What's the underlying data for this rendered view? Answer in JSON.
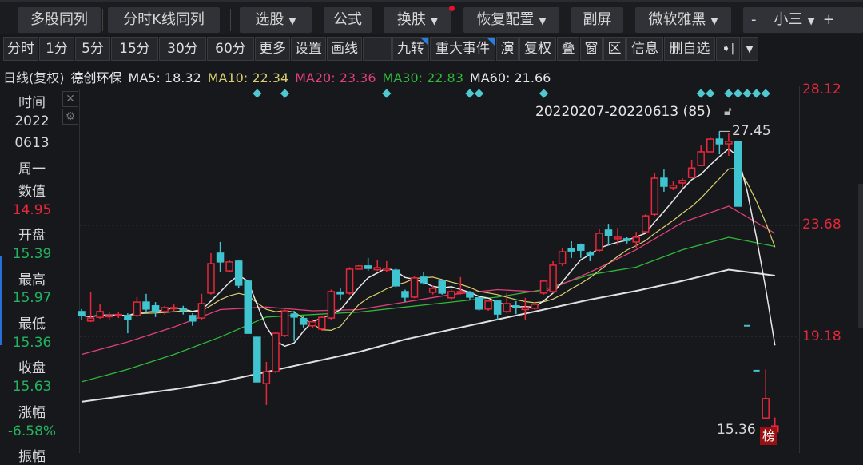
{
  "toolbar": {
    "buttons": [
      {
        "label": "多股同列"
      },
      {
        "label": "分时K线同列"
      },
      {
        "label": "选股",
        "dropdown": true
      },
      {
        "label": "公式"
      },
      {
        "label": "换肤",
        "dropdown": true
      },
      {
        "label": "恢复配置",
        "dropdown": true
      },
      {
        "label": "副屏"
      },
      {
        "label": "微软雅黑",
        "dropdown": true
      }
    ],
    "font_size": {
      "minus": "-",
      "value": "小三",
      "plus": "+"
    },
    "dropdown_arrow": "▼"
  },
  "periods": [
    "分时",
    "1分",
    "5分",
    "15分",
    "30分",
    "60分",
    "更多",
    "设置",
    "画线"
  ],
  "tools": [
    "九转",
    "重大事件",
    "演",
    "复权",
    "叠",
    "窗",
    "区",
    "信息",
    "删自选"
  ],
  "tools_extra": {
    "pin": "➧|",
    "more": "▼"
  },
  "info": {
    "period": "日线(复权)",
    "name": "德创环保",
    "ma5": "MA5: 18.32",
    "ma10": "MA10: 22.34",
    "ma20": "MA20: 23.36",
    "ma30": "MA30: 22.83",
    "ma60": "MA60: 21.66"
  },
  "colors": {
    "up": "#e8283c",
    "down": "#3fc4d0",
    "ma5": "#e8e8e8",
    "ma10": "#d8d070",
    "ma20": "#e0407a",
    "ma30": "#2fb83a",
    "ma60": "#e0e0e0",
    "green_value": "#22b45e"
  },
  "sidebar": [
    {
      "text": "时间",
      "c": "w"
    },
    {
      "text": "2022",
      "c": "w"
    },
    {
      "text": "0613",
      "c": "w"
    },
    {
      "text": "周一",
      "c": "w"
    },
    {
      "text": "数值",
      "c": "w"
    },
    {
      "text": "14.95",
      "c": "r"
    },
    {
      "text": "开盘",
      "c": "w"
    },
    {
      "text": "15.39",
      "c": "g"
    },
    {
      "text": "最高",
      "c": "w"
    },
    {
      "text": "15.97",
      "c": "g"
    },
    {
      "text": "最低",
      "c": "w"
    },
    {
      "text": "15.36",
      "c": "g"
    },
    {
      "text": "收盘",
      "c": "w"
    },
    {
      "text": "15.63",
      "c": "g"
    },
    {
      "text": "涨幅",
      "c": "w"
    },
    {
      "text": "-6.58%",
      "c": "g"
    },
    {
      "text": "振幅",
      "c": "w"
    }
  ],
  "sidebar_icons": {
    "close": "✕",
    "gear": "⚙"
  },
  "chart_data": {
    "type": "candlestick",
    "yaxis_labels": [
      "28.12",
      "23.68",
      "19.18"
    ],
    "range_label": "20220207-20220613 (85)",
    "high_label": "27.45",
    "low_label": "15.36",
    "badge": "榜",
    "marker_indices": [
      19,
      22,
      33,
      42,
      43,
      50,
      67,
      68,
      70,
      71,
      72,
      73,
      74
    ],
    "candles": [
      [
        20.22,
        20.06,
        20.32,
        19.9
      ],
      [
        19.84,
        19.96,
        21.02,
        19.8
      ],
      [
        19.99,
        20.22,
        20.54,
        19.93
      ],
      [
        20.06,
        20.06,
        20.22,
        19.9
      ],
      [
        20.06,
        20.1,
        20.22,
        19.96
      ],
      [
        20.06,
        19.9,
        20.15,
        19.35
      ],
      [
        20.06,
        20.6,
        20.8,
        20.0
      ],
      [
        20.6,
        20.32,
        20.93,
        20.17
      ],
      [
        20.45,
        20.22,
        20.6,
        20.0
      ],
      [
        20.22,
        20.38,
        20.45,
        20.1
      ],
      [
        20.35,
        20.38,
        20.5,
        20.25
      ],
      [
        20.32,
        20.3,
        20.45,
        20.1
      ],
      [
        20.06,
        19.84,
        20.15,
        19.65
      ],
      [
        19.96,
        20.54,
        20.93,
        19.9
      ],
      [
        20.96,
        22.14,
        22.56,
        20.9
      ],
      [
        22.56,
        22.21,
        23.01,
        21.82
      ],
      [
        21.85,
        22.21,
        22.3,
        21.8
      ],
      [
        22.24,
        21.28,
        22.3,
        21.18
      ],
      [
        21.44,
        19.35,
        21.44,
        19.35
      ],
      [
        19.19,
        17.4,
        19.19,
        17.4
      ],
      [
        17.33,
        17.81,
        18.2,
        16.47
      ],
      [
        17.81,
        19.35,
        19.42,
        17.75
      ],
      [
        19.26,
        20.25,
        20.3,
        19.2
      ],
      [
        20.12,
        20.0,
        20.25,
        19.04
      ],
      [
        19.94,
        19.71,
        20.06,
        19.58
      ],
      [
        19.65,
        19.81,
        19.9,
        19.55
      ],
      [
        19.52,
        19.99,
        20.06,
        19.45
      ],
      [
        19.96,
        21.02,
        21.1,
        19.9
      ],
      [
        21.0,
        20.93,
        21.15,
        20.67
      ],
      [
        20.96,
        21.92,
        22.0,
        20.9
      ],
      [
        21.92,
        22.05,
        22.08,
        21.9
      ],
      [
        22.05,
        21.95,
        22.37,
        21.85
      ],
      [
        21.9,
        21.98,
        22.3,
        21.85
      ],
      [
        21.88,
        21.95,
        22.24,
        21.82
      ],
      [
        21.88,
        21.25,
        21.95,
        21.2
      ],
      [
        21.02,
        20.8,
        21.1,
        20.6
      ],
      [
        20.8,
        21.57,
        21.65,
        20.75
      ],
      [
        21.6,
        21.38,
        21.8,
        21.3
      ],
      [
        20.99,
        21.15,
        21.25,
        20.9
      ],
      [
        21.44,
        20.96,
        21.5,
        20.9
      ],
      [
        20.77,
        21.02,
        21.1,
        20.7
      ],
      [
        20.96,
        21.02,
        21.6,
        20.9
      ],
      [
        20.96,
        20.8,
        21.05,
        20.7
      ],
      [
        20.77,
        20.32,
        20.85,
        20.25
      ],
      [
        20.32,
        20.64,
        20.7,
        20.25
      ],
      [
        20.64,
        20.12,
        20.7,
        19.9
      ],
      [
        20.22,
        20.54,
        20.96,
        20.15
      ],
      [
        20.45,
        20.4,
        20.64,
        20.12
      ],
      [
        20.3,
        20.38,
        20.77,
        19.9
      ],
      [
        20.35,
        20.51,
        20.6,
        20.3
      ],
      [
        20.96,
        21.44,
        21.5,
        20.9
      ],
      [
        21.02,
        22.08,
        22.24,
        20.96
      ],
      [
        22.14,
        22.62,
        22.78,
        22.05
      ],
      [
        22.75,
        22.65,
        23.04,
        22.37
      ],
      [
        22.91,
        22.68,
        22.95,
        22.37
      ],
      [
        22.56,
        22.5,
        22.65,
        22.24
      ],
      [
        22.68,
        23.36,
        23.52,
        22.62
      ],
      [
        23.49,
        23.26,
        23.74,
        22.88
      ],
      [
        23.14,
        23.2,
        23.58,
        22.88
      ],
      [
        23.14,
        23.07,
        23.2,
        22.95
      ],
      [
        23.01,
        23.2,
        23.42,
        22.78
      ],
      [
        23.42,
        24.06,
        24.12,
        23.36
      ],
      [
        24.12,
        25.57,
        25.76,
        24.06
      ],
      [
        25.57,
        25.25,
        25.92,
        25.03
      ],
      [
        25.19,
        25.29,
        25.44,
        25.09
      ],
      [
        25.38,
        25.48,
        25.57,
        25.19
      ],
      [
        25.6,
        25.98,
        26.31,
        25.57
      ],
      [
        26.08,
        26.63,
        26.88,
        26.05
      ],
      [
        26.63,
        27.14,
        27.2,
        26.6
      ],
      [
        27.14,
        26.95,
        27.45,
        26.53
      ],
      [
        26.95,
        27.05,
        27.37,
        26.47
      ],
      [
        27.05,
        24.45,
        27.05,
        24.45
      ],
      [
        19.65,
        19.65,
        19.65,
        19.65
      ],
      [
        17.85,
        17.85,
        17.85,
        17.85
      ],
      [
        15.95,
        16.73,
        17.9,
        15.9
      ],
      [
        15.39,
        15.63,
        15.97,
        15.36
      ]
    ],
    "ma_sample_step": 5,
    "ma20": [
      18.5,
      19.0,
      19.6,
      20.3,
      20.4,
      20.25,
      20.3,
      20.6,
      20.9,
      21.1,
      21.0,
      21.8,
      22.7,
      23.8,
      24.45,
      23.36
    ],
    "ma30": [
      17.4,
      17.9,
      18.5,
      19.2,
      20.0,
      20.1,
      20.2,
      20.4,
      20.6,
      20.8,
      21.1,
      21.7,
      22.0,
      22.7,
      23.2,
      22.83
    ],
    "ma60": [
      16.6,
      16.85,
      17.1,
      17.4,
      17.8,
      18.2,
      18.6,
      19.1,
      19.5,
      19.9,
      20.3,
      20.7,
      21.05,
      21.45,
      21.9,
      21.66
    ]
  }
}
